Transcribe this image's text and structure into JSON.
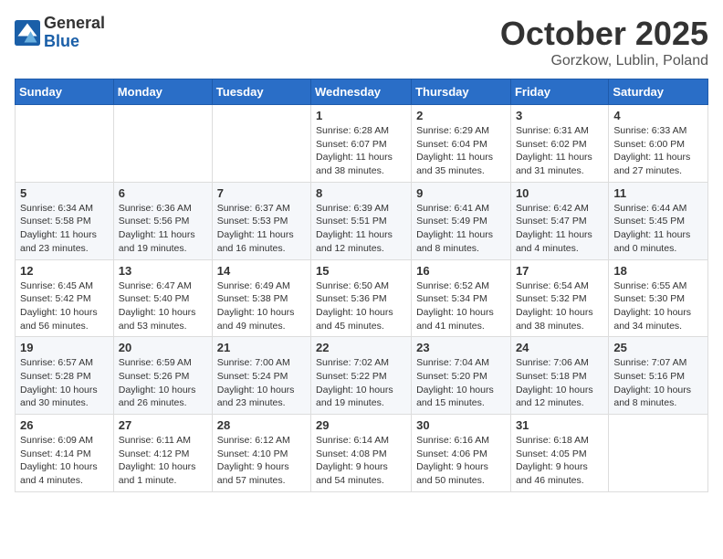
{
  "logo": {
    "general": "General",
    "blue": "Blue"
  },
  "header": {
    "month": "October 2025",
    "location": "Gorzkow, Lublin, Poland"
  },
  "weekdays": [
    "Sunday",
    "Monday",
    "Tuesday",
    "Wednesday",
    "Thursday",
    "Friday",
    "Saturday"
  ],
  "weeks": [
    [
      {
        "day": "",
        "info": ""
      },
      {
        "day": "",
        "info": ""
      },
      {
        "day": "",
        "info": ""
      },
      {
        "day": "1",
        "info": "Sunrise: 6:28 AM\nSunset: 6:07 PM\nDaylight: 11 hours\nand 38 minutes."
      },
      {
        "day": "2",
        "info": "Sunrise: 6:29 AM\nSunset: 6:04 PM\nDaylight: 11 hours\nand 35 minutes."
      },
      {
        "day": "3",
        "info": "Sunrise: 6:31 AM\nSunset: 6:02 PM\nDaylight: 11 hours\nand 31 minutes."
      },
      {
        "day": "4",
        "info": "Sunrise: 6:33 AM\nSunset: 6:00 PM\nDaylight: 11 hours\nand 27 minutes."
      }
    ],
    [
      {
        "day": "5",
        "info": "Sunrise: 6:34 AM\nSunset: 5:58 PM\nDaylight: 11 hours\nand 23 minutes."
      },
      {
        "day": "6",
        "info": "Sunrise: 6:36 AM\nSunset: 5:56 PM\nDaylight: 11 hours\nand 19 minutes."
      },
      {
        "day": "7",
        "info": "Sunrise: 6:37 AM\nSunset: 5:53 PM\nDaylight: 11 hours\nand 16 minutes."
      },
      {
        "day": "8",
        "info": "Sunrise: 6:39 AM\nSunset: 5:51 PM\nDaylight: 11 hours\nand 12 minutes."
      },
      {
        "day": "9",
        "info": "Sunrise: 6:41 AM\nSunset: 5:49 PM\nDaylight: 11 hours\nand 8 minutes."
      },
      {
        "day": "10",
        "info": "Sunrise: 6:42 AM\nSunset: 5:47 PM\nDaylight: 11 hours\nand 4 minutes."
      },
      {
        "day": "11",
        "info": "Sunrise: 6:44 AM\nSunset: 5:45 PM\nDaylight: 11 hours\nand 0 minutes."
      }
    ],
    [
      {
        "day": "12",
        "info": "Sunrise: 6:45 AM\nSunset: 5:42 PM\nDaylight: 10 hours\nand 56 minutes."
      },
      {
        "day": "13",
        "info": "Sunrise: 6:47 AM\nSunset: 5:40 PM\nDaylight: 10 hours\nand 53 minutes."
      },
      {
        "day": "14",
        "info": "Sunrise: 6:49 AM\nSunset: 5:38 PM\nDaylight: 10 hours\nand 49 minutes."
      },
      {
        "day": "15",
        "info": "Sunrise: 6:50 AM\nSunset: 5:36 PM\nDaylight: 10 hours\nand 45 minutes."
      },
      {
        "day": "16",
        "info": "Sunrise: 6:52 AM\nSunset: 5:34 PM\nDaylight: 10 hours\nand 41 minutes."
      },
      {
        "day": "17",
        "info": "Sunrise: 6:54 AM\nSunset: 5:32 PM\nDaylight: 10 hours\nand 38 minutes."
      },
      {
        "day": "18",
        "info": "Sunrise: 6:55 AM\nSunset: 5:30 PM\nDaylight: 10 hours\nand 34 minutes."
      }
    ],
    [
      {
        "day": "19",
        "info": "Sunrise: 6:57 AM\nSunset: 5:28 PM\nDaylight: 10 hours\nand 30 minutes."
      },
      {
        "day": "20",
        "info": "Sunrise: 6:59 AM\nSunset: 5:26 PM\nDaylight: 10 hours\nand 26 minutes."
      },
      {
        "day": "21",
        "info": "Sunrise: 7:00 AM\nSunset: 5:24 PM\nDaylight: 10 hours\nand 23 minutes."
      },
      {
        "day": "22",
        "info": "Sunrise: 7:02 AM\nSunset: 5:22 PM\nDaylight: 10 hours\nand 19 minutes."
      },
      {
        "day": "23",
        "info": "Sunrise: 7:04 AM\nSunset: 5:20 PM\nDaylight: 10 hours\nand 15 minutes."
      },
      {
        "day": "24",
        "info": "Sunrise: 7:06 AM\nSunset: 5:18 PM\nDaylight: 10 hours\nand 12 minutes."
      },
      {
        "day": "25",
        "info": "Sunrise: 7:07 AM\nSunset: 5:16 PM\nDaylight: 10 hours\nand 8 minutes."
      }
    ],
    [
      {
        "day": "26",
        "info": "Sunrise: 6:09 AM\nSunset: 4:14 PM\nDaylight: 10 hours\nand 4 minutes."
      },
      {
        "day": "27",
        "info": "Sunrise: 6:11 AM\nSunset: 4:12 PM\nDaylight: 10 hours\nand 1 minute."
      },
      {
        "day": "28",
        "info": "Sunrise: 6:12 AM\nSunset: 4:10 PM\nDaylight: 9 hours\nand 57 minutes."
      },
      {
        "day": "29",
        "info": "Sunrise: 6:14 AM\nSunset: 4:08 PM\nDaylight: 9 hours\nand 54 minutes."
      },
      {
        "day": "30",
        "info": "Sunrise: 6:16 AM\nSunset: 4:06 PM\nDaylight: 9 hours\nand 50 minutes."
      },
      {
        "day": "31",
        "info": "Sunrise: 6:18 AM\nSunset: 4:05 PM\nDaylight: 9 hours\nand 46 minutes."
      },
      {
        "day": "",
        "info": ""
      }
    ]
  ]
}
